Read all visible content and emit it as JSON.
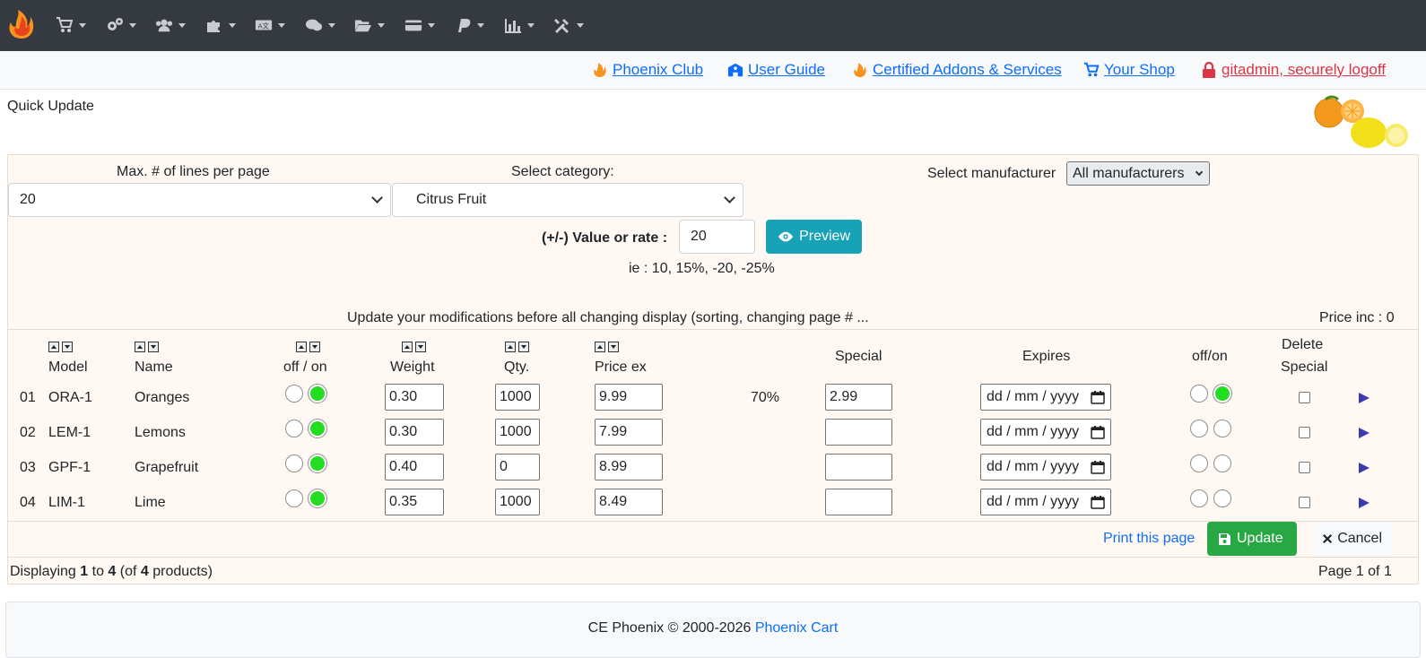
{
  "navbar": {
    "menus": [
      "catalog",
      "modules",
      "customers",
      "addons",
      "localization",
      "reports-chat",
      "tools-files",
      "payment",
      "paypal",
      "reports",
      "tools"
    ]
  },
  "links": {
    "phoenix_club": "Phoenix Club",
    "user_guide": "User Guide",
    "certified": "Certified Addons & Services",
    "your_shop": "Your Shop",
    "logoff": "gitadmin, securely logoff"
  },
  "page": {
    "title": "Quick Update"
  },
  "filters": {
    "lines_label": "Max. # of lines per page",
    "lines_value": "20",
    "category_label": "Select category:",
    "category_value": "Citrus Fruit",
    "manufacturer_label": "Select manufacturer",
    "manufacturer_value": "All manufacturers",
    "rate_label": "(+/-) Value or rate :",
    "rate_value": "20",
    "preview_label": "Preview",
    "hint": "ie : 10, 15%, -20, -25%",
    "notice": "Update your modifications before all changing display (sorting, changing page # ...",
    "price_inc": "Price inc : 0"
  },
  "table": {
    "headers": {
      "model": "Model",
      "name": "Name",
      "offon": "off / on",
      "weight": "Weight",
      "qty": "Qty.",
      "price_ex": "Price ex",
      "special": "Special",
      "expires": "Expires",
      "special_offon": "off/on",
      "delete_special_1": "Delete",
      "delete_special_2": "Special"
    },
    "rows": [
      {
        "num": "01",
        "model": "ORA-1",
        "name": "Oranges",
        "weight": "0.30",
        "qty": "1000",
        "price": "9.99",
        "discount": "70%",
        "special": "2.99",
        "expires": "dd / mm / yyyy",
        "status_on": true,
        "special_on": true
      },
      {
        "num": "02",
        "model": "LEM-1",
        "name": "Lemons",
        "weight": "0.30",
        "qty": "1000",
        "price": "7.99",
        "discount": "",
        "special": "",
        "expires": "dd / mm / yyyy",
        "status_on": true,
        "special_on": false
      },
      {
        "num": "03",
        "model": "GPF-1",
        "name": "Grapefruit",
        "weight": "0.40",
        "qty": "0",
        "price": "8.99",
        "discount": "",
        "special": "",
        "expires": "dd / mm / yyyy",
        "status_on": true,
        "special_on": false
      },
      {
        "num": "04",
        "model": "LIM-1",
        "name": "Lime",
        "weight": "0.35",
        "qty": "1000",
        "price": "8.49",
        "discount": "",
        "special": "",
        "expires": "dd / mm / yyyy",
        "status_on": true,
        "special_on": false
      }
    ]
  },
  "actions": {
    "print": "Print this page",
    "update": "Update",
    "cancel": "Cancel"
  },
  "pagination": {
    "displaying_prefix": "Displaying",
    "from": "1",
    "to_word": "to",
    "to": "4",
    "of_prefix": "(of",
    "total": "4",
    "of_suffix": "products)",
    "page_info": "Page 1 of 1"
  },
  "footer": {
    "text": "CE Phoenix © 2000-2026",
    "link": "Phoenix Cart"
  }
}
